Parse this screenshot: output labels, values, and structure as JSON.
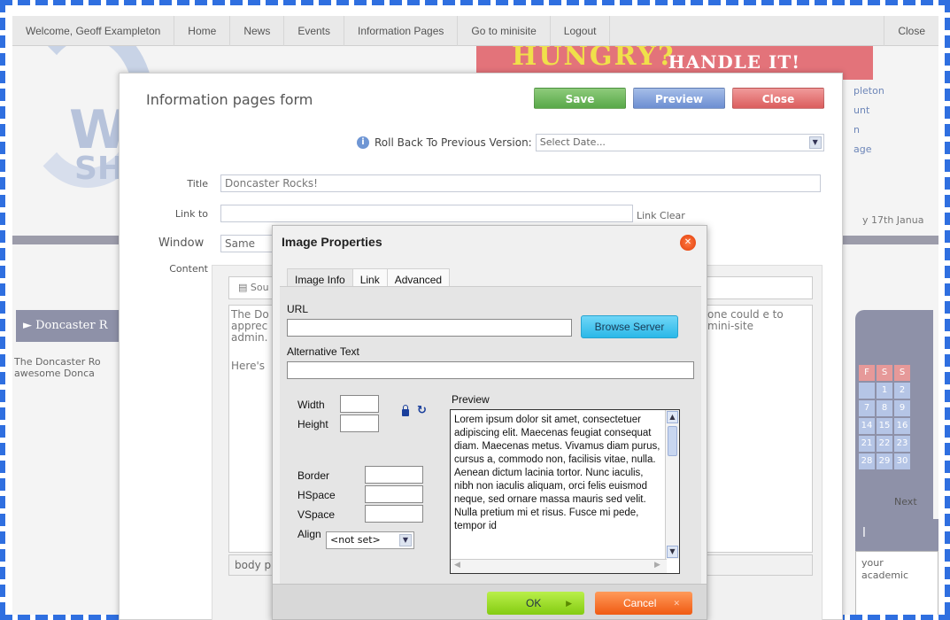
{
  "nav": {
    "welcome": "Welcome, Geoff Exampleton",
    "items": [
      "Home",
      "News",
      "Events",
      "Information Pages",
      "Go to minisite",
      "Logout"
    ],
    "close": "Close"
  },
  "background": {
    "banner_left": "HUNGRY?",
    "banner_right": "HANDLE IT!",
    "logo_top": "W",
    "logo_bottom": "SH",
    "right_links": [
      "pleton",
      "unt",
      "n",
      "age"
    ],
    "date_text": "y 17th Janua",
    "sidebar_heading": "► Doncaster R",
    "sidebar_text": "The Doncaster Ro awesome Donca",
    "calendar_headers": [
      "F",
      "S",
      "S"
    ],
    "calendar_days": [
      "",
      "1",
      "2",
      "7",
      "8",
      "9",
      "14",
      "15",
      "16",
      "21",
      "22",
      "23",
      "28",
      "29",
      "30"
    ],
    "calendar_next": "Next",
    "bottom_panel_heading": "l",
    "bottom_panel_text": "your academic"
  },
  "form": {
    "title": "Information pages form",
    "buttons": {
      "save": "Save",
      "preview": "Preview",
      "close": "Close"
    },
    "rollback_label": "Roll Back To Previous Version:",
    "rollback_value": "Select Date...",
    "title_label": "Title",
    "title_value": "Doncaster Rocks!",
    "link_label": "Link to",
    "link_value": "",
    "link_clear": "Link Clear",
    "window_label": "Window",
    "window_value": "Same",
    "content_label": "Content",
    "editor_source": "Sou",
    "editor_left_text": "The Do apprec admin.",
    "editor_here": "Here's",
    "editor_right_text": "one could e to mini-site",
    "editor_footer": "body p"
  },
  "dialog": {
    "title": "Image Properties",
    "tabs": [
      "Image Info",
      "Link",
      "Advanced"
    ],
    "url_label": "URL",
    "url_value": "",
    "browse_label": "Browse Server",
    "alt_label": "Alternative Text",
    "width_label": "Width",
    "height_label": "Height",
    "border_label": "Border",
    "hspace_label": "HSpace",
    "vspace_label": "VSpace",
    "align_label": "Align",
    "align_value": "<not set>",
    "preview_label": "Preview",
    "preview_text": "Lorem ipsum dolor sit amet, consectetuer adipiscing elit. Maecenas feugiat consequat diam. Maecenas metus. Vivamus diam purus, cursus a, commodo non, facilisis vitae, nulla. Aenean dictum lacinia tortor. Nunc iaculis, nibh non iaculis aliquam, orci felis euismod neque, sed ornare massa mauris sed velit. Nulla pretium mi et risus. Fusce mi pede, tempor id",
    "ok_label": "OK",
    "cancel_label": "Cancel"
  },
  "colors": {
    "frame": "#2f6fe0",
    "save": "#58a848",
    "preview": "#6c8ed2",
    "close": "#db5d5d",
    "ok": "#84cc12",
    "cancel": "#f05a12",
    "browse": "#2bb8e8"
  }
}
